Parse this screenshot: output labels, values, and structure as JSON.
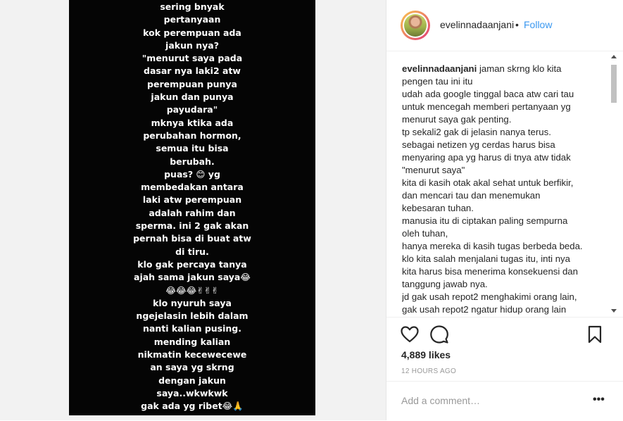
{
  "post": {
    "image_text_lines": [
      "sering bnyak",
      "pertanyaan",
      "kok perempuan ada",
      "jakun nya?",
      "\"menurut saya pada",
      "dasar nya laki2 atw",
      "perempuan punya",
      "jakun dan punya",
      "payudara\"",
      "mknya ktika ada",
      "perubahan hormon,",
      "semua itu bisa",
      "berubah.",
      "puas? 😊 yg",
      "membedakan antara",
      "laki atw perempuan",
      "adalah rahim dan",
      "sperma.  ini 2 gak akan",
      "pernah bisa di buat atw",
      "di tiru.",
      "klo gak percaya tanya",
      "ajah sama jakun saya😂",
      "😂😂😂✌✌✌",
      "klo nyuruh saya",
      "ngejelasin lebih dalam",
      "nanti kalian pusing.",
      "mending kalian",
      "nikmatin kecewecewe",
      "an saya yg skrng",
      "dengan jakun",
      "saya..wkwkwk",
      "gak ada yg ribet😂🙏"
    ]
  },
  "header": {
    "username": "evelinnadaanjani",
    "separator": "•",
    "follow_label": "Follow"
  },
  "caption": {
    "username": "evelinnadaanjani",
    "first_line": " jaman skrng klo kita",
    "lines": [
      "pengen tau ini itu",
      "udah ada google tinggal baca atw cari tau",
      "untuk mencegah memberi pertanyaan yg",
      "menurut saya gak penting.",
      "tp sekali2 gak di jelasin nanya terus.",
      "sebagai netizen yg cerdas harus bisa",
      "menyaring apa yg harus di tnya atw tidak",
      "\"menurut saya\"",
      "kita di kasih otak akal sehat untuk berfikir,",
      "dan mencari tau dan menemukan",
      "kebesaran tuhan.",
      "manusia itu di ciptakan paling sempurna",
      "oleh tuhan,",
      "hanya mereka di kasih tugas berbeda beda.",
      "klo kita salah menjalani tugas itu, inti nya",
      "kita harus bisa menerima konsekuensi dan",
      "tanggung jawab nya.",
      "jd gak usah repot2 menghakimi orang lain,",
      "gak usah repot2 ngatur hidup orang lain",
      "😊"
    ]
  },
  "actions": {
    "likes": "4,889 likes",
    "timestamp": "12 HOURS AGO"
  },
  "comment": {
    "placeholder": "Add a comment…",
    "more": "•••"
  },
  "icons": {
    "like": "heart-icon",
    "comment": "comment-bubble-icon",
    "save": "bookmark-icon",
    "more": "more-options-icon"
  },
  "colors": {
    "link": "#3897f0",
    "image_bg": "#050505",
    "muted": "#999999"
  }
}
